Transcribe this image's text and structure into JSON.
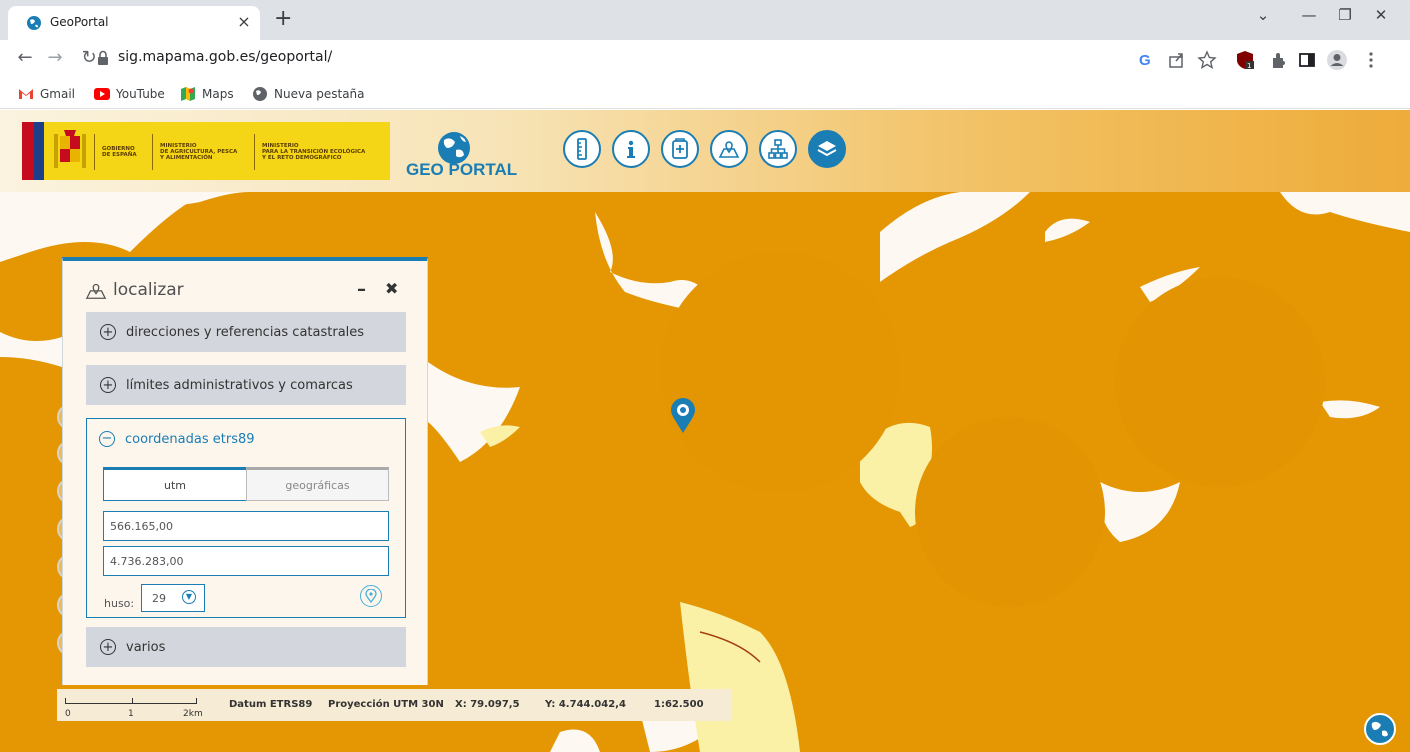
{
  "browser": {
    "tab_title": "GeoPortal",
    "tab_close": "×",
    "new_tab": "+",
    "url": "sig.mapama.gob.es/geoportal/",
    "bookmarks": [
      "Gmail",
      "YouTube",
      "Maps",
      "Nueva pestaña"
    ],
    "window_controls": {
      "dropdown": "⌄",
      "minimize": "—",
      "restore": "❐",
      "close": "✕"
    },
    "nav": {
      "back": "←",
      "forward": "→",
      "reload": "↻"
    }
  },
  "header": {
    "gov_lines": [
      "GOBIERNO",
      "DE ESPAÑA"
    ],
    "ministry1": [
      "MINISTERIO",
      "DE AGRICULTURA, PESCA",
      "Y ALIMENTACIÓN"
    ],
    "ministry2": [
      "MINISTERIO",
      "PARA LA TRANSICIÓN ECOLÓGICA",
      "Y EL RETO DEMOGRÁFICO"
    ],
    "geo_title": "GEO PORTAL",
    "tools": [
      "ruler-icon",
      "info-icon",
      "bookmark-add-icon",
      "map-pin-icon",
      "sitemap-icon",
      "layers-icon"
    ]
  },
  "panel": {
    "title": "localizar",
    "minimize": "–",
    "close": "✖",
    "sections": {
      "direcciones": "direcciones y referencias catastrales",
      "limites": "límites administrativos y comarcas",
      "coordenadas": "coordenadas etrs89",
      "varios": "varios"
    },
    "tabs": {
      "utm": "utm",
      "geograficas": "geográficas"
    },
    "x_value": "566.165,00",
    "y_value": "4.736.283,00",
    "huso_label": "huso:",
    "huso_value": "29"
  },
  "statusbar": {
    "scale_labels": [
      "0",
      "1",
      "2km"
    ],
    "datum": "Datum ETRS89",
    "projection": "Proyección UTM 30N",
    "x": "X: 79.097,5",
    "y": "Y: 4.744.042,4",
    "scale": "1:62.500"
  },
  "colors": {
    "map_orange": "#e49603",
    "map_white": "#fdf9f2",
    "map_yellow": "#fbf1a6",
    "accent_blue": "#1a7db4"
  }
}
